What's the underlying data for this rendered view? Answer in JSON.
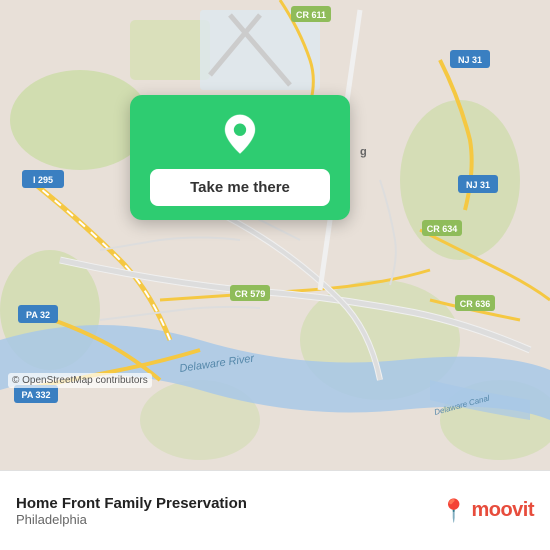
{
  "map": {
    "background_color": "#e8e0d8",
    "copyright": "© OpenStreetMap contributors"
  },
  "popup": {
    "button_label": "Take me there",
    "pin_color": "#ffffff"
  },
  "bottom_bar": {
    "location_name": "Home Front Family Preservation",
    "location_city": "Philadelphia",
    "moovit_brand": "moovit"
  }
}
